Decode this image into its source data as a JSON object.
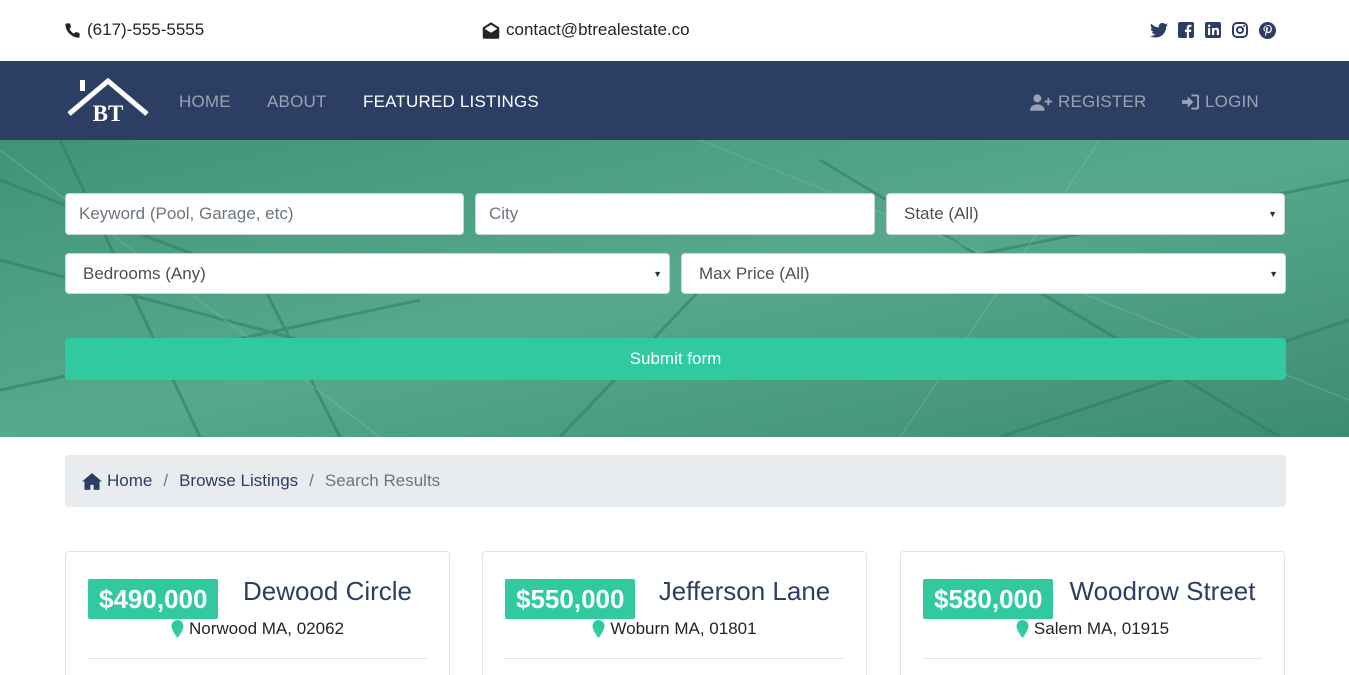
{
  "topbar": {
    "phone": "(617)-555-5555",
    "email": "contact@btrealestate.co",
    "social_icons": [
      "twitter-icon",
      "facebook-icon",
      "linkedin-icon",
      "instagram-icon",
      "pinterest-icon"
    ]
  },
  "nav": {
    "logo_text": "BT",
    "items": [
      {
        "label": "HOME"
      },
      {
        "label": "ABOUT"
      },
      {
        "label": "FEATURED LISTINGS"
      }
    ],
    "register_label": "REGISTER",
    "login_label": "LOGIN"
  },
  "search": {
    "keyword_placeholder": "Keyword (Pool, Garage, etc)",
    "city_placeholder": "City",
    "state_selected": "State (All)",
    "bedrooms_selected": "Bedrooms (Any)",
    "max_price_selected": "Max Price (All)",
    "submit_label": "Submit form"
  },
  "breadcrumb": {
    "home": "Home",
    "browse": "Browse Listings",
    "current": "Search Results",
    "separator": "/"
  },
  "listings": [
    {
      "title": "Dewood Circle",
      "price": "$490,000",
      "location": "Norwood MA, 02062"
    },
    {
      "title": "Jefferson Lane",
      "price": "$550,000",
      "location": "Woburn MA, 01801"
    },
    {
      "title": "Woodrow Street",
      "price": "$580,000",
      "location": "Salem MA, 01915"
    }
  ],
  "colors": {
    "brand_navy": "#2c3e64",
    "accent_green": "#30c9a0",
    "hero_green": "#4a9f83"
  }
}
